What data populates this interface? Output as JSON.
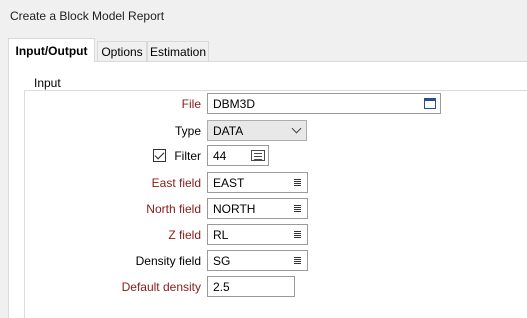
{
  "window": {
    "title": "Create a Block Model Report"
  },
  "tabs": [
    {
      "label": "Input/Output",
      "active": true
    },
    {
      "label": "Options",
      "active": false
    },
    {
      "label": "Estimation",
      "active": false
    }
  ],
  "input_group": {
    "label": "Input",
    "file": {
      "label": "File",
      "value": "DBM3D",
      "icon": "file-browse-icon"
    },
    "type": {
      "label": "Type",
      "value": "DATA",
      "icon": "chevron-down-icon"
    },
    "filter": {
      "label": "Filter",
      "checked": true,
      "value": "44",
      "icon": "filter-list-icon"
    },
    "east_field": {
      "label": "East field",
      "value": "EAST"
    },
    "north_field": {
      "label": "North field",
      "value": "NORTH"
    },
    "z_field": {
      "label": "Z field",
      "value": "RL"
    },
    "density_field": {
      "label": "Density field",
      "value": "SG"
    },
    "default_density": {
      "label": "Default density",
      "value": "2.5"
    }
  },
  "colors": {
    "required_label": "#8b1a1a",
    "panel_bg": "#ffffff",
    "window_bg": "#f0f0f0"
  }
}
